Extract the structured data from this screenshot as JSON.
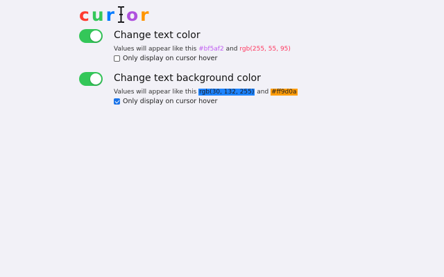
{
  "logo": {
    "letters": [
      {
        "char": "c",
        "color": "#ff3b30"
      },
      {
        "char": "u",
        "color": "#34c759"
      },
      {
        "char": "r",
        "color": "#007aff"
      },
      {
        "char": "I",
        "color": "#1c1c1e",
        "icon": "text-cursor-icon"
      },
      {
        "char": "o",
        "color": "#af52de"
      },
      {
        "char": "r",
        "color": "#ff9500"
      }
    ]
  },
  "settings": [
    {
      "title": "Change text color",
      "enabled": true,
      "desc_prefix": "Values will appear like this",
      "sample1": "#bf5af2",
      "desc_and": "and",
      "sample2": "rgb(255, 55, 95)",
      "sample1_color": "#bf5af2",
      "sample2_color": "#ff375f",
      "hover_label": "Only display on cursor hover",
      "hover_checked": false
    },
    {
      "title": "Change text background color",
      "enabled": true,
      "desc_prefix": "Values will appear like this",
      "sample1": "rgb(30, 132, 255)",
      "desc_and": "and",
      "sample2": "#ff9d0a",
      "sample1_color": "#1e84ff",
      "sample2_color": "#ff9d0a",
      "hover_label": "Only display on cursor hover",
      "hover_checked": true
    }
  ],
  "colors": {
    "toggle_on": "#34c759",
    "background": "#f2f1f7",
    "checkbox_checked": "#1a73e8"
  }
}
